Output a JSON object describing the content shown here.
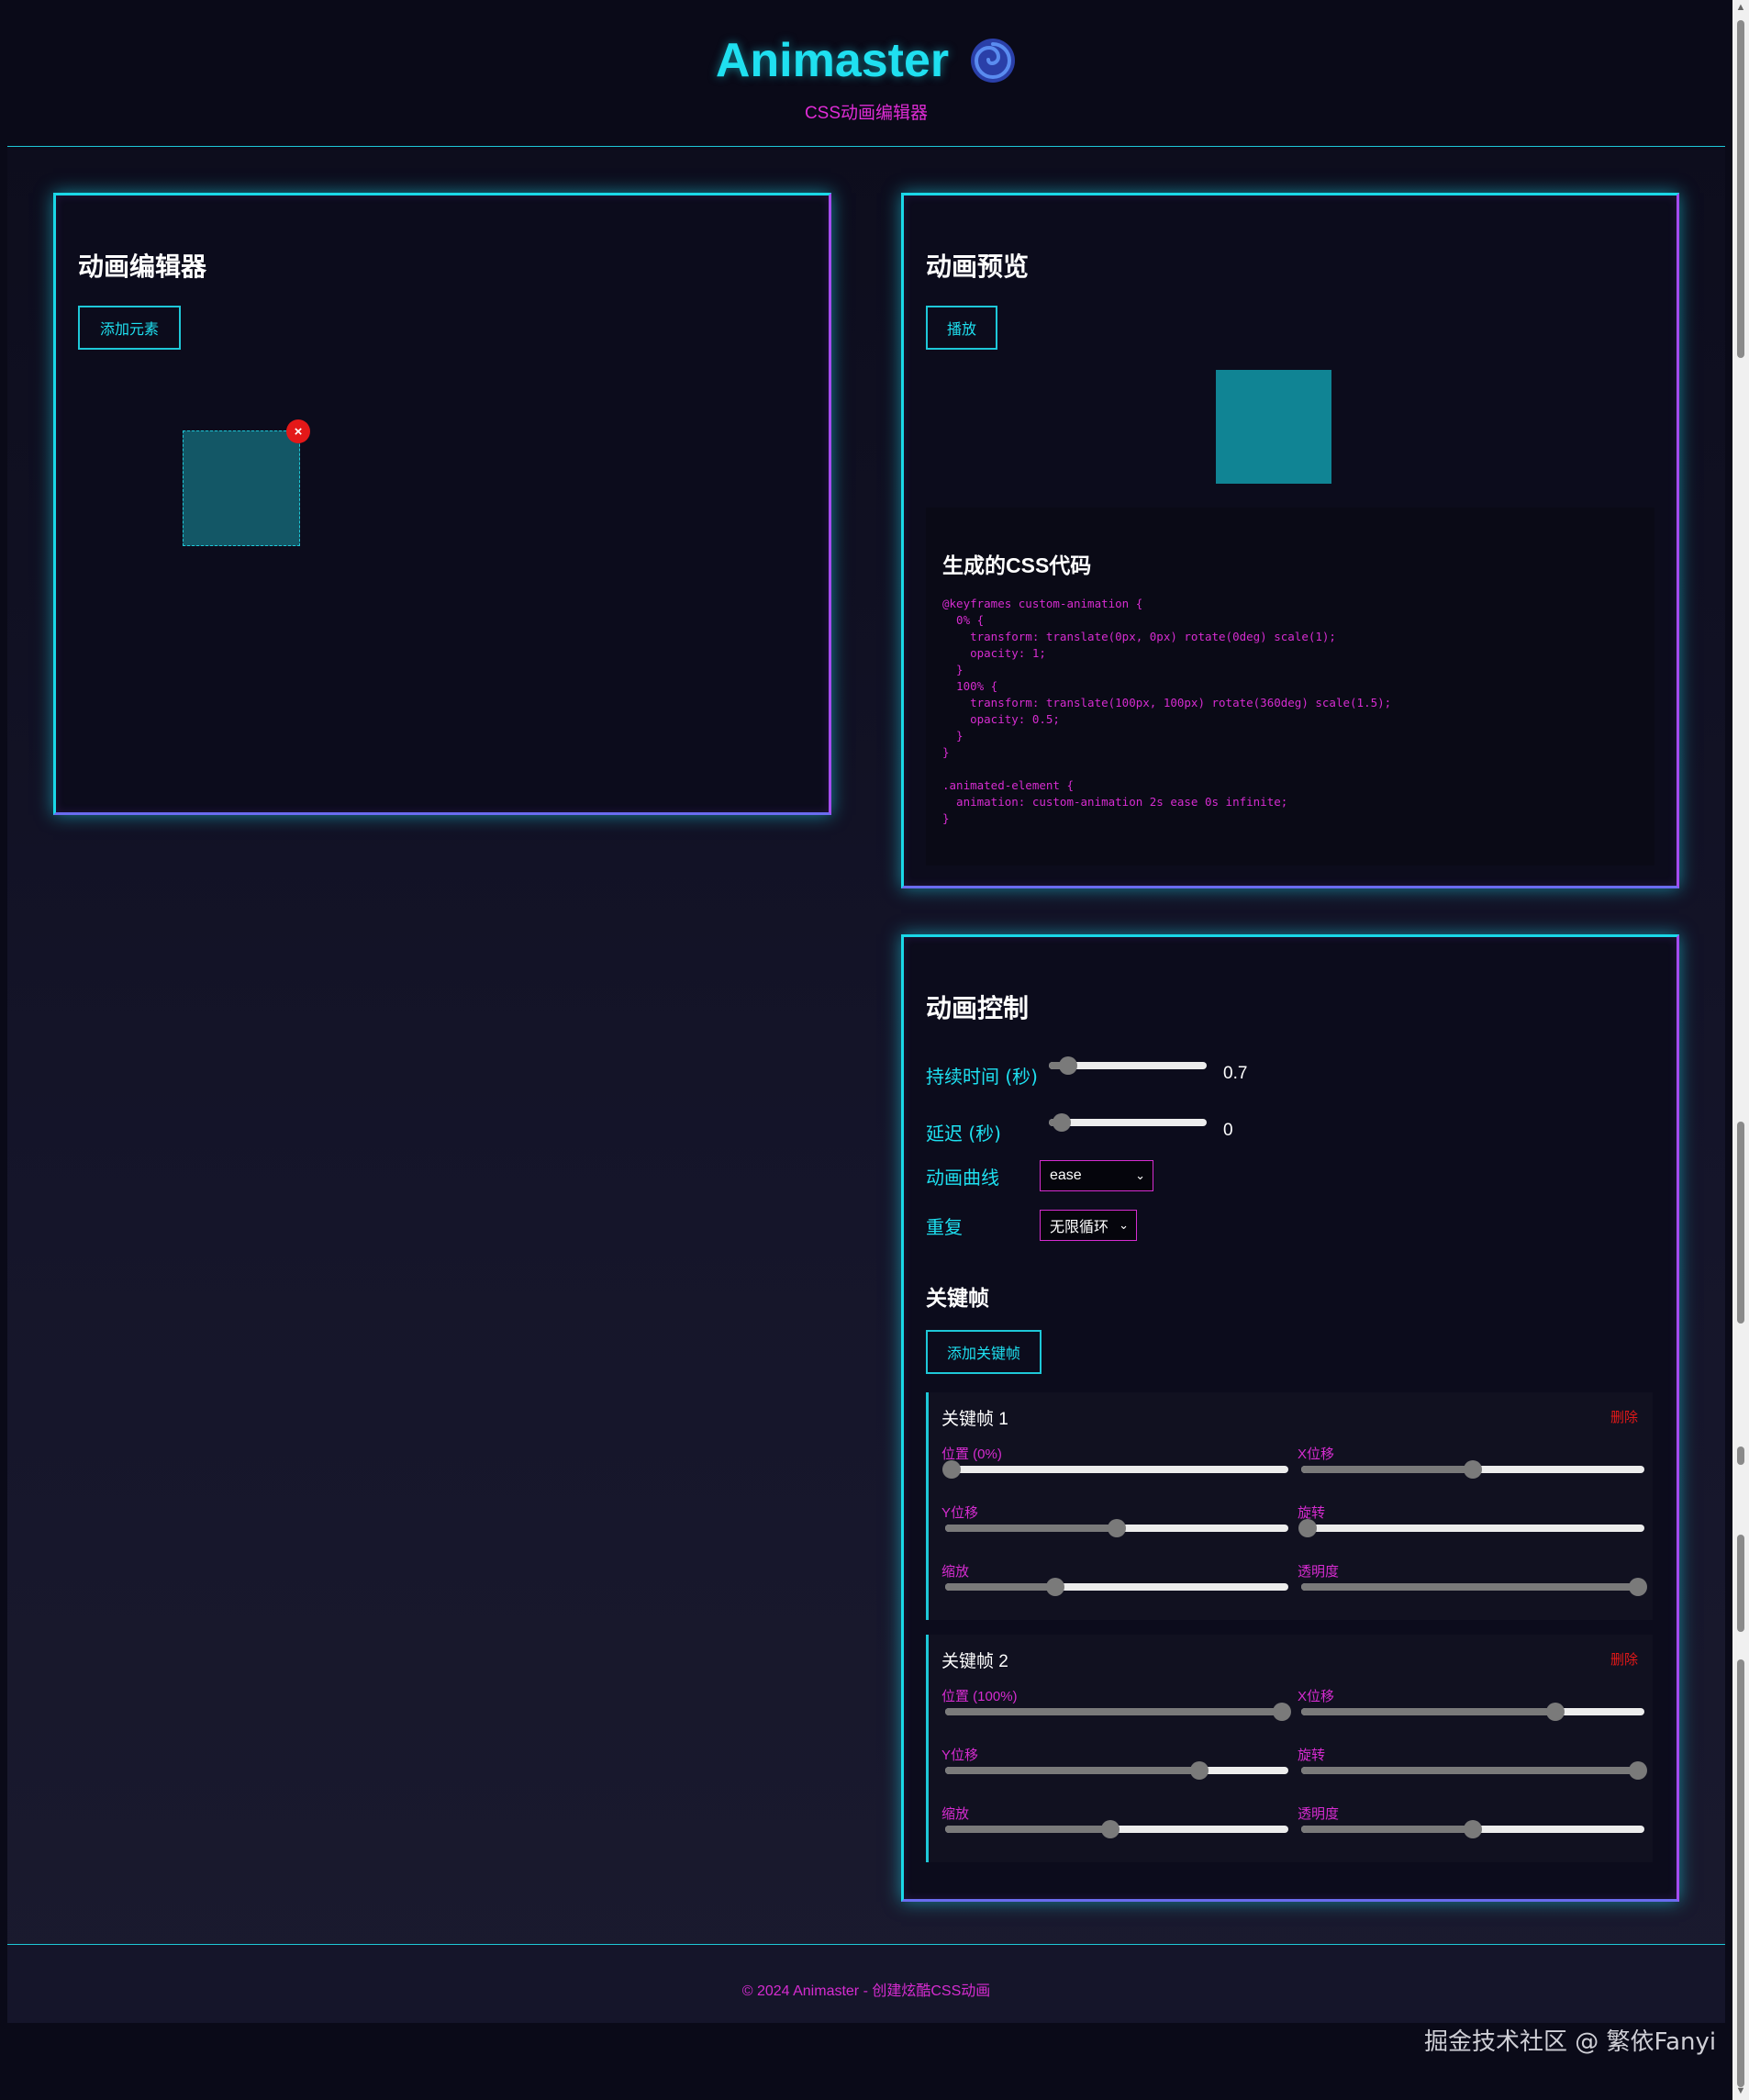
{
  "header": {
    "title": "Animaster",
    "subtitle": "CSS动画编辑器",
    "logo_icon": "spiral-icon"
  },
  "editor": {
    "title": "动画编辑器",
    "add_element_label": "添加元素",
    "delete_badge": "×"
  },
  "preview": {
    "title": "动画预览",
    "play_label": "播放",
    "code_title": "生成的CSS代码",
    "code_lines": [
      "@keyframes custom-animation {",
      "  0% {",
      "    transform: translate(0px, 0px) rotate(0deg) scale(1);",
      "    opacity: 1;",
      "  }",
      "  100% {",
      "    transform: translate(100px, 100px) rotate(360deg) scale(1.5);",
      "    opacity: 0.5;",
      "  }",
      "}",
      "",
      ".animated-element {",
      "  animation: custom-animation 2s ease 0s infinite;",
      "}"
    ]
  },
  "controls": {
    "title": "动画控制",
    "duration_label": "持续时间 (秒)",
    "duration_value": "0.7",
    "duration_fraction": 0.12,
    "delay_label": "延迟 (秒)",
    "delay_value": "0",
    "delay_fraction": 0.08,
    "easing_label": "动画曲线",
    "easing_value": "ease",
    "repeat_label": "重复",
    "repeat_value": "无限循环",
    "keyframes_title": "关键帧",
    "add_keyframe_label": "添加关键帧"
  },
  "keyframes": [
    {
      "title": "关键帧 1",
      "delete_label": "删除",
      "fields": [
        {
          "label": "位置 (0%)",
          "fraction": 0.02
        },
        {
          "label": "X位移",
          "fraction": 0.5
        },
        {
          "label": "Y位移",
          "fraction": 0.5
        },
        {
          "label": "旋转",
          "fraction": 0.02
        },
        {
          "label": "缩放",
          "fraction": 0.32
        },
        {
          "label": "透明度",
          "fraction": 0.98
        }
      ]
    },
    {
      "title": "关键帧 2",
      "delete_label": "删除",
      "fields": [
        {
          "label": "位置 (100%)",
          "fraction": 0.98
        },
        {
          "label": "X位移",
          "fraction": 0.74
        },
        {
          "label": "Y位移",
          "fraction": 0.74
        },
        {
          "label": "旋转",
          "fraction": 0.98
        },
        {
          "label": "缩放",
          "fraction": 0.48
        },
        {
          "label": "透明度",
          "fraction": 0.5
        }
      ]
    }
  ],
  "footer": {
    "text": "© 2024 Animaster - 创建炫酷CSS动画"
  },
  "watermark": "掘金技术社区 @ 繁依Fanyi",
  "colors": {
    "accent_cyan": "#1ee0f0",
    "accent_magenta": "#d62cd0",
    "danger_red": "#e41818",
    "background": "#0a0a18"
  }
}
